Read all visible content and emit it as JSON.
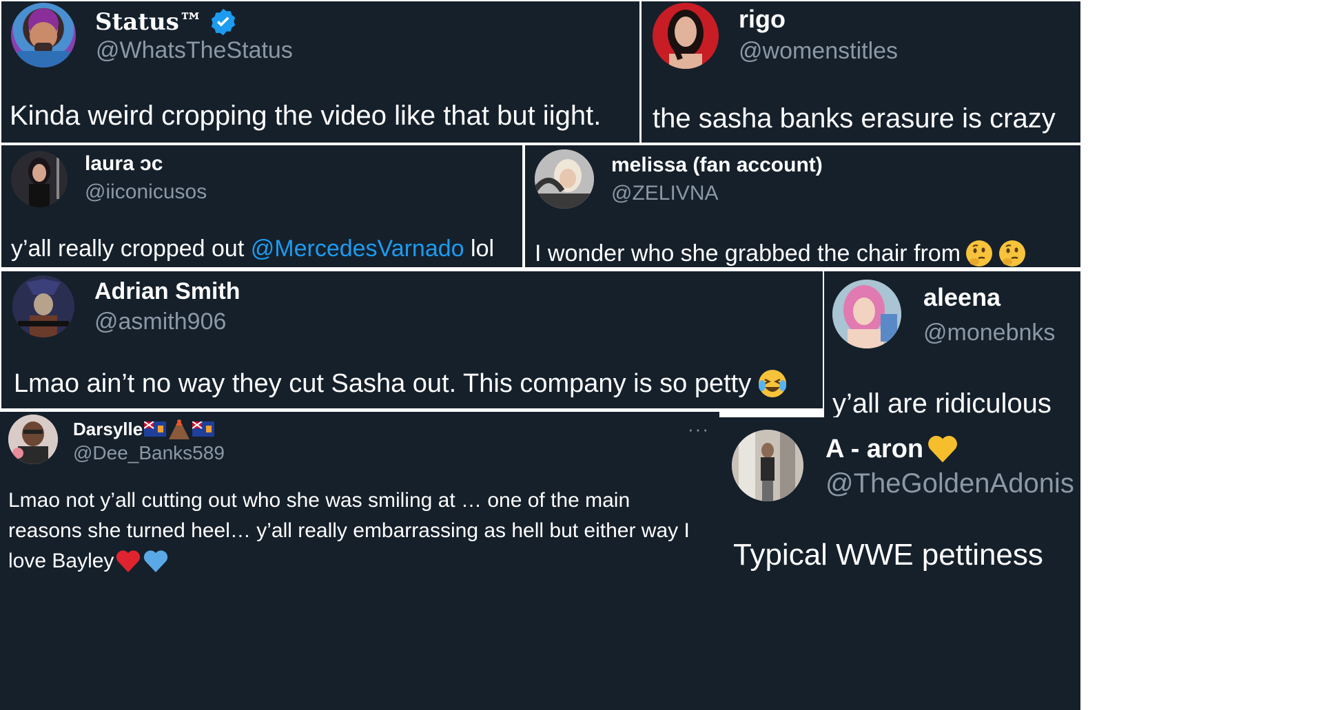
{
  "tweets": [
    {
      "name": "Status™",
      "handle": "@WhatsTheStatus",
      "verified": true,
      "text": "Kinda weird cropping the video like that but iight."
    },
    {
      "name": "rigo",
      "handle": "@womenstitles",
      "text": "the sasha banks erasure is crazy"
    },
    {
      "name": "laura ↄc",
      "handle": "@iiconicusos",
      "text_before": "y’all really cropped out ",
      "mention": "@MercedesVarnado",
      "text_after": " lol"
    },
    {
      "name": "melissa (fan account)",
      "handle": "@ZELIVNA",
      "text": "I wonder who she grabbed the chair from",
      "emojis": [
        "thinking-face",
        "thinking-face"
      ]
    },
    {
      "name": "Adrian Smith",
      "handle": "@asmith906",
      "text": "Lmao ain’t no way they cut Sasha out. This company is so petty",
      "emojis": [
        "crying-laughing-face"
      ]
    },
    {
      "name": "aleena",
      "handle": "@monebnks",
      "text": "y’all are ridiculous"
    },
    {
      "name": "Darsylle",
      "handle": "@Dee_Banks589",
      "more": "···",
      "name_emojis": [
        "flag-anguilla",
        "volcano",
        "flag-anguilla"
      ],
      "lines": [
        "Lmao not y’all cutting out who she was smiling at … one of the main",
        "reasons she turned heel… y’all really embarrassing as hell but either way I",
        "love Bayley"
      ],
      "emojis": [
        "red-heart",
        "blue-heart"
      ]
    },
    {
      "name": "A - aron",
      "handle": "@TheGoldenAdonis",
      "name_emojis": [
        "yellow-heart"
      ],
      "text": "Typical WWE pettiness"
    }
  ],
  "colors": {
    "card_bg": "#15202b",
    "handle": "#8b98a5",
    "text": "#ffffff",
    "mention": "#1d9bf0",
    "verified": "#1d9bf0"
  }
}
